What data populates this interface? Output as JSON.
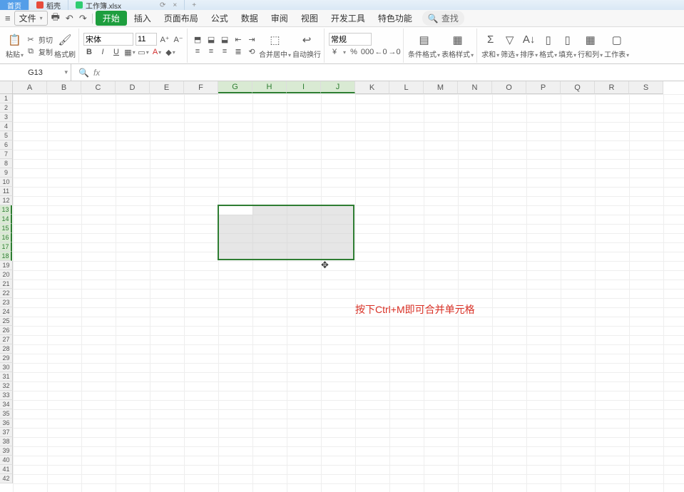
{
  "titlebar": {
    "tabs": [
      {
        "label": "首页"
      },
      {
        "label": "稻壳"
      },
      {
        "label": "工作簿.xlsx"
      }
    ],
    "reload_icon": "⟳",
    "close_icon": "×",
    "plus_icon": "+"
  },
  "menubar": {
    "hamburger": "≡",
    "file_label": "文件",
    "file_dd": "▾",
    "icons": [
      "🖶",
      "↶",
      "↷",
      "⤺"
    ],
    "items": [
      "开始",
      "插入",
      "页面布局",
      "公式",
      "数据",
      "审阅",
      "视图",
      "开发工具",
      "特色功能"
    ],
    "search_icon": "🔍",
    "search_label": "查找"
  },
  "ribbon": {
    "paste_label": "粘贴",
    "cut_label": "剪切",
    "copy_label": "复制",
    "format_painter_label": "格式刷",
    "font_name": "宋体",
    "font_size": "11",
    "bold": "B",
    "italic": "I",
    "underline": "U",
    "merge_label": "合并居中",
    "wrap_label": "自动换行",
    "number_format": "常规",
    "cond_fmt_label": "条件格式",
    "table_style_label": "表格样式",
    "sum_label": "求和",
    "filter_label": "筛选",
    "sort_label": "排序",
    "format_label": "格式",
    "fill_label": "填充",
    "rowcol_label": "行和列",
    "worksheet_label": "工作表",
    "currency": "¥",
    "percent": "%",
    "comma": "000",
    "inc_dec": "←0",
    "dec_inc": "→0"
  },
  "formula_bar": {
    "name_box": "G13",
    "fx": "fx"
  },
  "grid": {
    "columns": [
      "A",
      "B",
      "C",
      "D",
      "E",
      "F",
      "G",
      "H",
      "I",
      "J",
      "K",
      "L",
      "M",
      "N",
      "O",
      "P",
      "Q",
      "R",
      "S"
    ],
    "row_count": 42,
    "selected_cols": [
      "G",
      "H",
      "I",
      "J"
    ],
    "selected_rows": [
      13,
      14,
      15,
      16,
      17,
      18
    ]
  },
  "annotation": "按下Ctrl+M即可合并单元格"
}
